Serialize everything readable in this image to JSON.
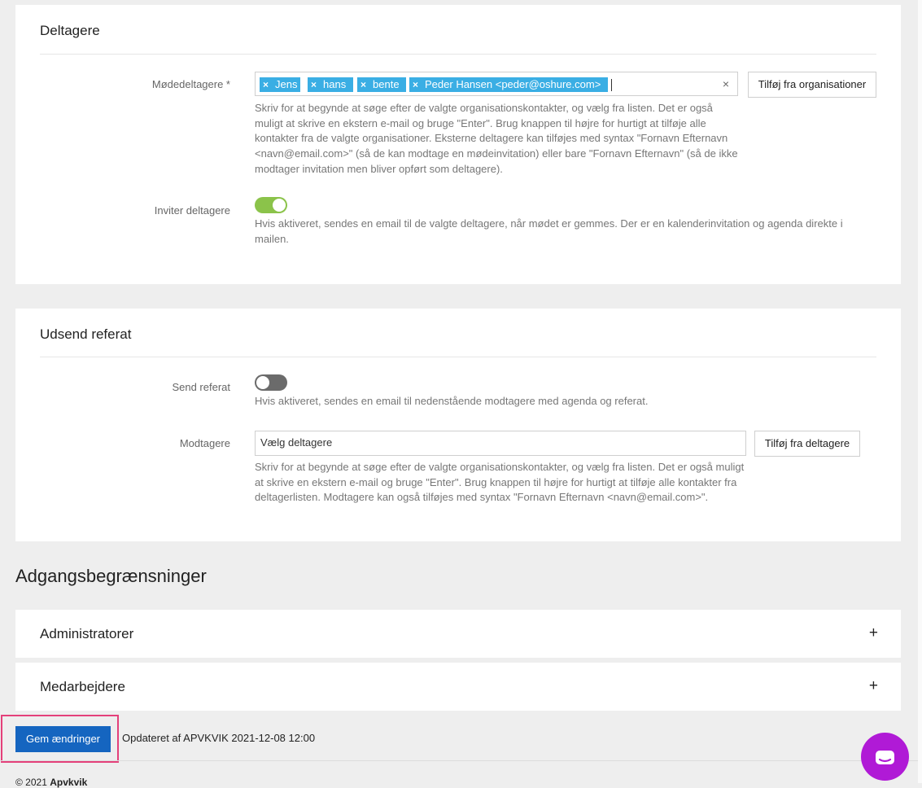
{
  "participants_section": {
    "title": "Deltagere",
    "attendees_label": "Mødedeltagere *",
    "tags": [
      "Jens",
      "hans",
      "bente",
      "Peder Hansen <peder@oshure.com>"
    ],
    "tag_remove_glyph": "×",
    "clear_glyph": "×",
    "add_from_orgs_label": "Tilføj fra organisationer",
    "attendees_help": [
      "Skriv for at begynde at søge efter de valgte organisationskontakter, og vælg fra listen. Det er også",
      "muligt at skrive en ekstern e-mail og bruge \"Enter\". Brug knappen til højre for hurtigt at tilføje alle",
      "kontakter fra de valgte organisationer. Eksterne deltagere kan tilføjes med syntax \"Fornavn Efternavn",
      "<navn@email.com>\" (så de kan modtage en mødeinvitation) eller bare \"Fornavn Efternavn\" (så de ikke",
      "modtager invitation men bliver opført som deltagere)."
    ],
    "invite_label": "Inviter deltagere",
    "invite_enabled": true,
    "invite_help": [
      "Hvis aktiveret, sendes en email til de valgte deltagere, når mødet er gemmes. Der er en kalenderinvitation og agenda direkte i",
      "mailen."
    ]
  },
  "minutes_section": {
    "title": "Udsend referat",
    "send_label": "Send referat",
    "send_enabled": false,
    "send_help": "Hvis aktiveret, sendes en email til nedenstående modtagere med agenda og referat.",
    "recipients_label": "Modtagere",
    "recipients_placeholder": "Vælg deltagere",
    "add_from_participants_label": "Tilføj fra deltagere",
    "recipients_help": [
      "Skriv for at begynde at søge efter de valgte organisationskontakter, og vælg fra listen. Det er også muligt",
      "at skrive en ekstern e-mail og bruge \"Enter\". Brug knappen til højre for hurtigt at tilføje alle kontakter fra",
      "deltagerlisten. Modtagere kan også tilføjes med syntax \"Fornavn Efternavn <navn@email.com>\"."
    ]
  },
  "access": {
    "heading": "Adgangsbegrænsninger",
    "panels": [
      {
        "title": "Administratorer",
        "expand_glyph": "+"
      },
      {
        "title": "Medarbejdere",
        "expand_glyph": "+"
      }
    ]
  },
  "footer": {
    "save_label": "Gem ændringer",
    "updated_text": "Opdateret af APVKVIK 2021-12-08 12:00",
    "copyright_prefix": "© 2021",
    "copyright_brand": "Apvkvik"
  },
  "colors": {
    "tag_blue": "#3aaee4",
    "toggle_on": "#8bc34a",
    "toggle_off": "#6b6b6b",
    "primary": "#1565c0",
    "highlight": "#e4407a",
    "chat": "#b01ad6"
  },
  "icons": {
    "chat": "chat-icon"
  }
}
